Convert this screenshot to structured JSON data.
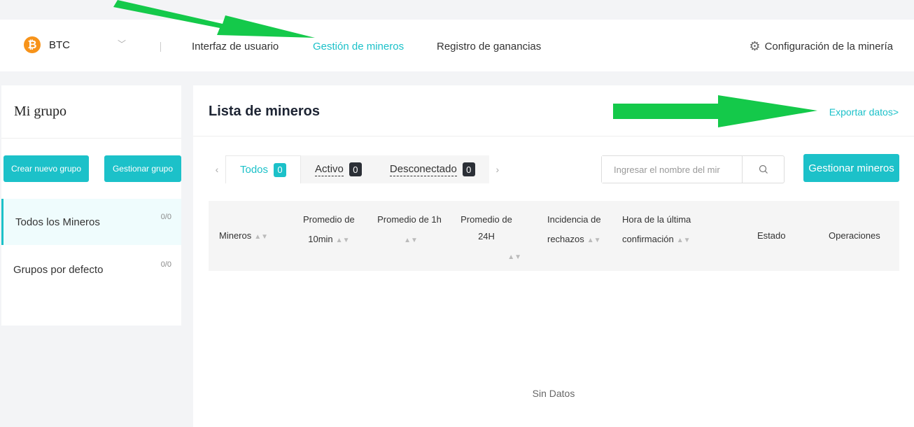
{
  "nav": {
    "coin": "BTC",
    "items": [
      "Interfaz de usuario",
      "Gestión de mineros",
      "Registro de ganancias"
    ],
    "active_index": 1,
    "config_label": "Configuración de la minería"
  },
  "sidebar": {
    "title": "Mi grupo",
    "create_button": "Crear nuevo grupo",
    "manage_button": "Gestionar grupo",
    "groups": [
      {
        "label": "Todos los Mineros",
        "count": "0/0"
      },
      {
        "label": "Grupos por defecto",
        "count": "0/0"
      }
    ]
  },
  "main": {
    "title": "Lista de mineros",
    "export_link": "Exportar datos>",
    "tabs": [
      {
        "label": "Todos",
        "count": "0"
      },
      {
        "label": "Activo",
        "count": "0"
      },
      {
        "label": "Desconectado",
        "count": "0"
      }
    ],
    "search_placeholder": "Ingresar el nombre del mir",
    "manage_button": "Gestionar mineros",
    "columns": {
      "miners": "Mineros",
      "avg10_a": "Promedio de",
      "avg10_b": "10min",
      "avg1h": "Promedio de 1h",
      "avg24h": "Promedio de 24H",
      "reject_a": "Incidencia de",
      "reject_b": "rechazos",
      "last_a": "Hora de la última",
      "last_b": "confirmación",
      "status": "Estado",
      "ops": "Operaciones"
    },
    "empty_text": "Sin Datos"
  },
  "colors": {
    "accent": "#1cc1c9",
    "annotation_arrow": "#14c94a"
  }
}
